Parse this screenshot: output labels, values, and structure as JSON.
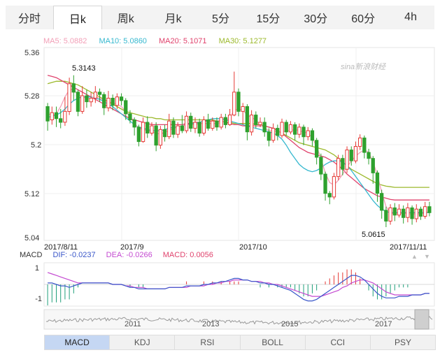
{
  "tabs": [
    {
      "label": "分时",
      "active": false
    },
    {
      "label": "日k",
      "active": true
    },
    {
      "label": "周k",
      "active": false
    },
    {
      "label": "月k",
      "active": false
    },
    {
      "label": "5分",
      "active": false
    },
    {
      "label": "15分",
      "active": false
    },
    {
      "label": "30分",
      "active": false
    },
    {
      "label": "60分",
      "active": false
    },
    {
      "label": "4h",
      "active": false
    }
  ],
  "ma_legend": {
    "ma5": "MA5: 5.0882",
    "ma10": "MA10: 5.0860",
    "ma20": "MA20: 5.1071",
    "ma30": "MA30: 5.1277"
  },
  "watermark": "sina新浪财经",
  "macd_legend": {
    "name": "MACD",
    "dif": "DIF: -0.0237",
    "dea": "DEA: -0.0266",
    "macd": "MACD: 0.0056"
  },
  "colors": {
    "up": "#e53935",
    "down": "#2ea12e",
    "ma5": "#f29fb7",
    "ma10": "#36b8cf",
    "ma20": "#e0436d",
    "ma30": "#9cb92c",
    "dif": "#3a57c9",
    "dea": "#c44ad1"
  },
  "chart_data": [
    {
      "type": "candlestick",
      "y_ticks": [
        "5.36",
        "5.28",
        "5.2",
        "5.12",
        "5.04"
      ],
      "x_ticks": [
        "2017/8/11",
        "2017/9",
        "2017/10",
        "2017/11/11"
      ],
      "ylim": [
        5.04,
        5.36
      ],
      "annotations": {
        "high_label": "5.3143",
        "low_label": "5.0615"
      },
      "candles": [
        [
          5.262,
          5.238,
          5.268,
          5.222
        ],
        [
          5.24,
          5.252,
          5.262,
          5.232
        ],
        [
          5.252,
          5.242,
          5.262,
          5.228
        ],
        [
          5.242,
          5.236,
          5.258,
          5.226
        ],
        [
          5.236,
          5.254,
          5.278,
          5.23
        ],
        [
          5.254,
          5.3,
          5.31,
          5.248
        ],
        [
          5.3,
          5.286,
          5.314,
          5.272
        ],
        [
          5.286,
          5.254,
          5.29,
          5.246
        ],
        [
          5.254,
          5.28,
          5.296,
          5.25
        ],
        [
          5.28,
          5.27,
          5.29,
          5.26
        ],
        [
          5.27,
          5.276,
          5.286,
          5.262
        ],
        [
          5.276,
          5.286,
          5.296,
          5.268
        ],
        [
          5.286,
          5.282,
          5.292,
          5.27
        ],
        [
          5.282,
          5.26,
          5.286,
          5.248
        ],
        [
          5.26,
          5.276,
          5.288,
          5.254
        ],
        [
          5.276,
          5.264,
          5.282,
          5.256
        ],
        [
          5.264,
          5.278,
          5.284,
          5.258
        ],
        [
          5.278,
          5.272,
          5.284,
          5.264
        ],
        [
          5.272,
          5.25,
          5.276,
          5.24
        ],
        [
          5.25,
          5.24,
          5.256,
          5.234
        ],
        [
          5.24,
          5.228,
          5.244,
          5.214
        ],
        [
          5.228,
          5.204,
          5.232,
          5.196
        ],
        [
          5.204,
          5.236,
          5.244,
          5.202
        ],
        [
          5.236,
          5.218,
          5.246,
          5.21
        ],
        [
          5.218,
          5.23,
          5.236,
          5.214
        ],
        [
          5.23,
          5.198,
          5.236,
          5.188
        ],
        [
          5.198,
          5.224,
          5.23,
          5.192
        ],
        [
          5.224,
          5.212,
          5.232,
          5.204
        ],
        [
          5.212,
          5.238,
          5.25,
          5.208
        ],
        [
          5.238,
          5.216,
          5.244,
          5.21
        ],
        [
          5.216,
          5.23,
          5.236,
          5.21
        ],
        [
          5.23,
          5.222,
          5.248,
          5.218
        ],
        [
          5.222,
          5.246,
          5.254,
          5.218
        ],
        [
          5.246,
          5.226,
          5.252,
          5.22
        ],
        [
          5.226,
          5.236,
          5.244,
          5.218
        ],
        [
          5.236,
          5.218,
          5.242,
          5.212
        ],
        [
          5.218,
          5.24,
          5.246,
          5.214
        ],
        [
          5.24,
          5.226,
          5.25,
          5.222
        ],
        [
          5.226,
          5.238,
          5.244,
          5.222
        ],
        [
          5.238,
          5.228,
          5.244,
          5.222
        ],
        [
          5.228,
          5.244,
          5.25,
          5.224
        ],
        [
          5.244,
          5.232,
          5.25,
          5.226
        ],
        [
          5.232,
          5.248,
          5.258,
          5.23
        ],
        [
          5.248,
          5.286,
          5.32,
          5.246
        ],
        [
          5.286,
          5.254,
          5.292,
          5.246
        ],
        [
          5.254,
          5.262,
          5.268,
          5.232
        ],
        [
          5.262,
          5.22,
          5.266,
          5.206
        ],
        [
          5.22,
          5.248,
          5.256,
          5.214
        ],
        [
          5.248,
          5.232,
          5.254,
          5.226
        ],
        [
          5.232,
          5.236,
          5.244,
          5.228
        ],
        [
          5.236,
          5.22,
          5.244,
          5.212
        ],
        [
          5.22,
          5.206,
          5.226,
          5.196
        ],
        [
          5.206,
          5.226,
          5.234,
          5.202
        ],
        [
          5.226,
          5.214,
          5.232,
          5.206
        ],
        [
          5.214,
          5.236,
          5.242,
          5.21
        ],
        [
          5.236,
          5.22,
          5.24,
          5.214
        ],
        [
          5.22,
          5.232,
          5.238,
          5.216
        ],
        [
          5.232,
          5.216,
          5.236,
          5.206
        ],
        [
          5.216,
          5.228,
          5.234,
          5.21
        ],
        [
          5.228,
          5.212,
          5.232,
          5.198
        ],
        [
          5.212,
          5.222,
          5.228,
          5.206
        ],
        [
          5.222,
          5.206,
          5.226,
          5.196
        ],
        [
          5.206,
          5.178,
          5.21,
          5.166
        ],
        [
          5.178,
          5.15,
          5.184,
          5.14
        ],
        [
          5.15,
          5.118,
          5.154,
          5.106
        ],
        [
          5.118,
          5.112,
          5.122,
          5.1
        ],
        [
          5.112,
          5.146,
          5.152,
          5.108
        ],
        [
          5.146,
          5.176,
          5.182,
          5.14
        ],
        [
          5.176,
          5.158,
          5.182,
          5.148
        ],
        [
          5.158,
          5.19,
          5.196,
          5.152
        ],
        [
          5.19,
          5.172,
          5.196,
          5.164
        ],
        [
          5.172,
          5.196,
          5.204,
          5.168
        ],
        [
          5.196,
          5.21,
          5.216,
          5.19
        ],
        [
          5.21,
          5.186,
          5.214,
          5.176
        ],
        [
          5.186,
          5.176,
          5.192,
          5.166
        ],
        [
          5.176,
          5.152,
          5.18,
          5.134
        ],
        [
          5.152,
          5.118,
          5.156,
          5.104
        ],
        [
          5.118,
          5.09,
          5.124,
          5.076
        ],
        [
          5.09,
          5.072,
          5.096,
          5.062
        ],
        [
          5.072,
          5.094,
          5.1,
          5.066
        ],
        [
          5.094,
          5.082,
          5.102,
          5.072
        ],
        [
          5.082,
          5.092,
          5.1,
          5.078
        ],
        [
          5.092,
          5.078,
          5.098,
          5.068
        ],
        [
          5.078,
          5.094,
          5.102,
          5.07
        ],
        [
          5.094,
          5.076,
          5.098,
          5.066
        ],
        [
          5.076,
          5.092,
          5.1,
          5.07
        ],
        [
          5.092,
          5.08,
          5.096,
          5.074
        ],
        [
          5.08,
          5.096,
          5.104,
          5.076
        ],
        [
          5.096,
          5.086,
          5.104,
          5.08
        ]
      ],
      "ma": {
        "ma5": [
          5.25,
          5.248,
          5.25,
          5.262,
          5.278,
          5.29,
          5.29,
          5.282,
          5.278,
          5.276,
          5.276,
          5.278,
          5.276,
          5.272,
          5.27,
          5.268,
          5.266,
          5.262,
          5.254,
          5.246,
          5.234,
          5.226,
          5.224,
          5.222,
          5.22,
          5.218,
          5.216,
          5.22,
          5.222,
          5.226,
          5.228,
          5.23,
          5.232,
          5.232,
          5.232,
          5.234,
          5.234,
          5.234,
          5.234,
          5.234,
          5.236,
          5.238,
          5.244,
          5.256,
          5.258,
          5.256,
          5.248,
          5.244,
          5.24,
          5.232,
          5.226,
          5.222,
          5.222,
          5.22,
          5.22,
          5.222,
          5.222,
          5.224,
          5.222,
          5.22,
          5.218,
          5.21,
          5.196,
          5.176,
          5.152,
          5.136,
          5.132,
          5.14,
          5.15,
          5.162,
          5.172,
          5.18,
          5.186,
          5.19,
          5.186,
          5.17,
          5.148,
          5.12,
          5.096,
          5.086,
          5.084,
          5.084,
          5.086,
          5.084,
          5.084,
          5.084,
          5.084,
          5.086,
          5.088
        ],
        "ma10": [
          5.244,
          5.246,
          5.248,
          5.252,
          5.258,
          5.266,
          5.272,
          5.276,
          5.278,
          5.278,
          5.278,
          5.276,
          5.274,
          5.27,
          5.266,
          5.262,
          5.256,
          5.25,
          5.244,
          5.238,
          5.232,
          5.228,
          5.226,
          5.224,
          5.222,
          5.222,
          5.222,
          5.224,
          5.226,
          5.228,
          5.228,
          5.23,
          5.232,
          5.234,
          5.234,
          5.236,
          5.238,
          5.24,
          5.242,
          5.242,
          5.242,
          5.24,
          5.238,
          5.236,
          5.234,
          5.232,
          5.23,
          5.228,
          5.226,
          5.224,
          5.222,
          5.22,
          5.218,
          5.214,
          5.208,
          5.198,
          5.186,
          5.176,
          5.166,
          5.16,
          5.156,
          5.154,
          5.156,
          5.16,
          5.166,
          5.17,
          5.172,
          5.172,
          5.17,
          5.164,
          5.156,
          5.146,
          5.136,
          5.126,
          5.116,
          5.106,
          5.098,
          5.092,
          5.088,
          5.086,
          5.086,
          5.086,
          5.086,
          5.086,
          5.086,
          5.086,
          5.086,
          5.086,
          5.086
        ],
        "ma20": [
          5.314,
          5.312,
          5.31,
          5.306,
          5.302,
          5.298,
          5.294,
          5.29,
          5.286,
          5.282,
          5.278,
          5.274,
          5.27,
          5.266,
          5.262,
          5.258,
          5.254,
          5.25,
          5.246,
          5.242,
          5.24,
          5.238,
          5.236,
          5.234,
          5.232,
          5.232,
          5.232,
          5.232,
          5.232,
          5.232,
          5.232,
          5.232,
          5.234,
          5.234,
          5.236,
          5.236,
          5.238,
          5.238,
          5.238,
          5.238,
          5.238,
          5.236,
          5.234,
          5.232,
          5.232,
          5.23,
          5.23,
          5.23,
          5.23,
          5.23,
          5.23,
          5.228,
          5.226,
          5.222,
          5.218,
          5.212,
          5.206,
          5.2,
          5.194,
          5.19,
          5.186,
          5.184,
          5.182,
          5.18,
          5.178,
          5.174,
          5.17,
          5.164,
          5.158,
          5.15,
          5.144,
          5.138,
          5.132,
          5.126,
          5.122,
          5.118,
          5.114,
          5.112,
          5.11,
          5.108,
          5.107,
          5.107,
          5.107,
          5.107,
          5.107,
          5.107,
          5.107,
          5.107,
          5.107
        ],
        "ma30": [
          5.3,
          5.302,
          5.304,
          5.304,
          5.304,
          5.302,
          5.3,
          5.298,
          5.294,
          5.29,
          5.286,
          5.282,
          5.278,
          5.274,
          5.27,
          5.266,
          5.262,
          5.258,
          5.254,
          5.252,
          5.25,
          5.248,
          5.246,
          5.244,
          5.244,
          5.242,
          5.242,
          5.24,
          5.24,
          5.24,
          5.24,
          5.24,
          5.24,
          5.24,
          5.24,
          5.24,
          5.24,
          5.24,
          5.24,
          5.238,
          5.238,
          5.236,
          5.236,
          5.234,
          5.234,
          5.234,
          5.234,
          5.234,
          5.232,
          5.232,
          5.23,
          5.228,
          5.226,
          5.222,
          5.218,
          5.214,
          5.21,
          5.206,
          5.202,
          5.2,
          5.198,
          5.196,
          5.194,
          5.192,
          5.19,
          5.186,
          5.182,
          5.176,
          5.17,
          5.164,
          5.158,
          5.154,
          5.15,
          5.146,
          5.142,
          5.138,
          5.134,
          5.132,
          5.13,
          5.129,
          5.128,
          5.128,
          5.128,
          5.128,
          5.128,
          5.128,
          5.128,
          5.128,
          5.128
        ]
      }
    },
    {
      "type": "macd",
      "y_ticks": [
        "1",
        "-1"
      ],
      "ylim": [
        -1.4,
        1.4
      ],
      "dif": [
        0.1,
        0.1,
        0.0,
        -0.1,
        -0.1,
        -0.2,
        -0.1,
        0.0,
        0.1,
        0.1,
        0.1,
        0.1,
        0.1,
        0.1,
        0.1,
        0.0,
        0.0,
        0.0,
        -0.1,
        -0.2,
        -0.2,
        -0.3,
        -0.3,
        -0.3,
        -0.3,
        -0.3,
        -0.3,
        -0.3,
        -0.2,
        -0.2,
        -0.2,
        -0.2,
        -0.1,
        -0.1,
        -0.1,
        -0.1,
        0.0,
        0.0,
        0.1,
        0.1,
        0.2,
        0.2,
        0.3,
        0.4,
        0.4,
        0.3,
        0.3,
        0.2,
        0.2,
        0.1,
        0.1,
        0.0,
        0.0,
        -0.1,
        -0.2,
        -0.3,
        -0.4,
        -0.6,
        -0.8,
        -1.0,
        -1.1,
        -1.1,
        -1.0,
        -0.8,
        -0.6,
        -0.4,
        -0.2,
        0.0,
        0.2,
        0.4,
        0.6,
        0.6,
        0.5,
        0.3,
        0.0,
        -0.3,
        -0.6,
        -0.8,
        -0.9,
        -0.9,
        -0.9,
        -0.8,
        -0.8,
        -0.8,
        -0.7,
        -0.7,
        -0.7,
        -0.6,
        -0.6
      ],
      "dea": [
        0.8,
        0.7,
        0.6,
        0.5,
        0.4,
        0.3,
        0.2,
        0.1,
        0.1,
        0.1,
        0.1,
        0.1,
        0.1,
        0.1,
        0.1,
        0.0,
        0.0,
        0.0,
        -0.1,
        -0.1,
        -0.2,
        -0.2,
        -0.2,
        -0.3,
        -0.3,
        -0.3,
        -0.3,
        -0.3,
        -0.2,
        -0.2,
        -0.2,
        -0.2,
        -0.2,
        -0.1,
        -0.1,
        -0.1,
        -0.1,
        0.0,
        0.0,
        0.1,
        0.1,
        0.2,
        0.2,
        0.3,
        0.3,
        0.3,
        0.3,
        0.2,
        0.2,
        0.2,
        0.1,
        0.1,
        0.0,
        0.0,
        -0.1,
        -0.2,
        -0.3,
        -0.4,
        -0.5,
        -0.6,
        -0.7,
        -0.8,
        -0.8,
        -0.8,
        -0.7,
        -0.6,
        -0.5,
        -0.4,
        -0.2,
        -0.1,
        0.1,
        0.2,
        0.3,
        0.3,
        0.2,
        0.1,
        -0.1,
        -0.3,
        -0.5,
        -0.6,
        -0.7,
        -0.7,
        -0.7,
        -0.7,
        -0.7,
        -0.7,
        -0.7,
        -0.6,
        -0.6
      ]
    },
    {
      "type": "area",
      "x_ticks": [
        "2011",
        "2013",
        "2015",
        "2017"
      ]
    }
  ]
}
